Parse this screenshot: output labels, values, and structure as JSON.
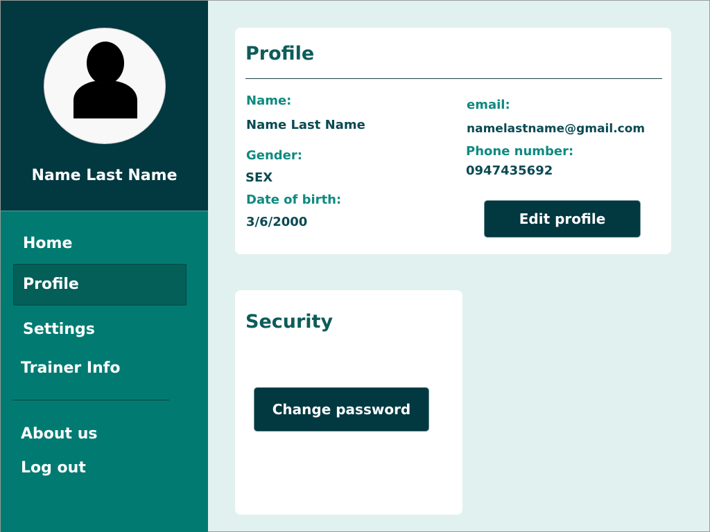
{
  "sidebar": {
    "user_name": "Name Last Name",
    "nav": {
      "home": "Home",
      "profile": "Profile",
      "settings": "Settings",
      "trainer_info": "Trainer Info",
      "about_us": "About us",
      "log_out": "Log out"
    },
    "active_item": "Profile",
    "avatar_icon": "user-silhouette-icon"
  },
  "profile": {
    "title": "Profile",
    "name_label": "Name:",
    "name_value": "Name Last Name",
    "gender_label": "Gender:",
    "gender_value": "SEX",
    "dob_label": "Date of birth:",
    "dob_value": "3/6/2000",
    "email_label": "email:",
    "email_value": "namelastname@gmail.com",
    "phone_label": "Phone number:",
    "phone_value": "0947435692",
    "edit_button": "Edit profile"
  },
  "security": {
    "title": "Security",
    "change_password_button": "Change password"
  },
  "colors": {
    "sidebar_dark": "#023840",
    "sidebar_teal": "#017b72",
    "background": "#e0f1f0",
    "accent_label": "#0e8a80",
    "button": "#023840"
  }
}
